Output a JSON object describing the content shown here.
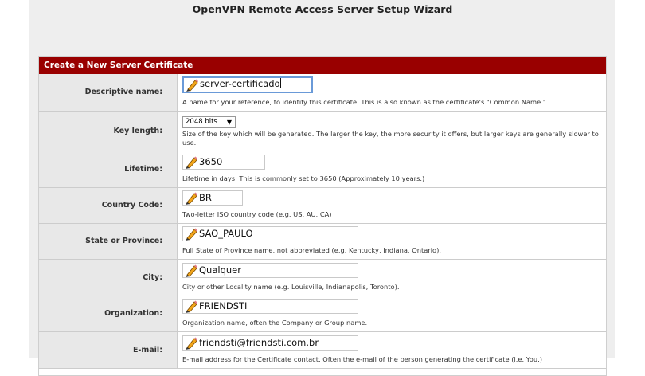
{
  "page": {
    "title": "OpenVPN Remote Access Server Setup Wizard"
  },
  "panel": {
    "header": "Create a New Server Certificate"
  },
  "fields": {
    "descriptive_name": {
      "label": "Descriptive name:",
      "value": "server-certificado",
      "help": "A name for your reference, to identify this certificate. This is also known as the certificate's \"Common Name.\""
    },
    "key_length": {
      "label": "Key length:",
      "selected": "2048 bits",
      "help": "Size of the key which will be generated. The larger the key, the more security it offers, but larger keys are generally slower to use."
    },
    "lifetime": {
      "label": "Lifetime:",
      "value": "3650",
      "help": "Lifetime in days. This is commonly set to 3650 (Approximately 10 years.)"
    },
    "country_code": {
      "label": "Country Code:",
      "value": "BR",
      "help": "Two-letter ISO country code (e.g. US, AU, CA)"
    },
    "state": {
      "label": "State or Province:",
      "value": "SAO_PAULO",
      "help": "Full State of Province name, not abbreviated (e.g. Kentucky, Indiana, Ontario)."
    },
    "city": {
      "label": "City:",
      "value": "Qualquer",
      "help": "City or other Locality name (e.g. Louisville, Indianapolis, Toronto)."
    },
    "organization": {
      "label": "Organization:",
      "value": "FRIENDSTI",
      "help": "Organization name, often the Company or Group name."
    },
    "email": {
      "label": "E-mail:",
      "value": "friendsti@friendsti.com.br",
      "help": "E-mail address for the Certificate contact. Often the e-mail of the person generating the certificate (i.e. You.)"
    }
  },
  "icons": {
    "input_marker": "pencil-icon",
    "select_arrow": "▼"
  }
}
